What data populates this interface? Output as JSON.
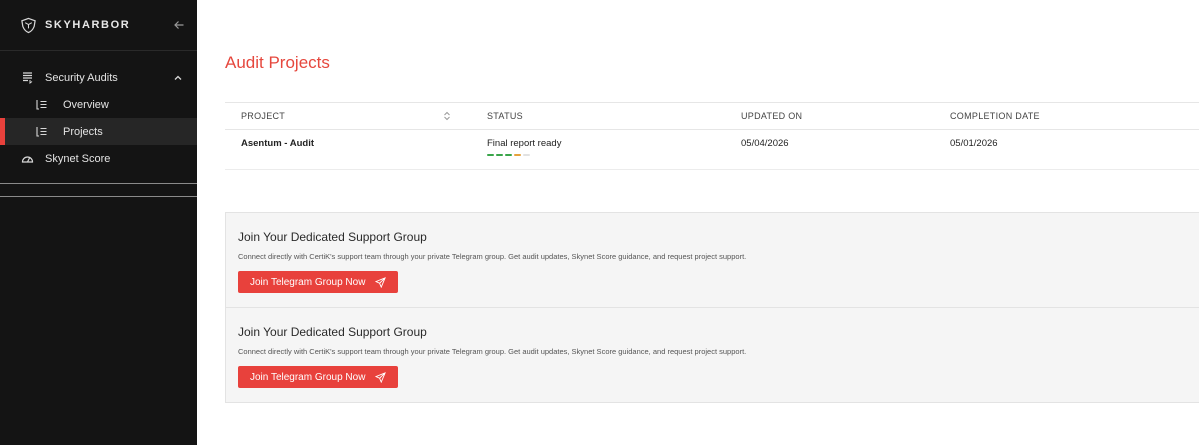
{
  "brand": {
    "name": "SKYHARBOR"
  },
  "sidebar": {
    "items": [
      {
        "label": "Security Audits",
        "icon": "document-list-icon",
        "expanded": true
      },
      {
        "label": "Overview",
        "icon": "list-icon"
      },
      {
        "label": "Projects",
        "icon": "list-icon",
        "active": true
      },
      {
        "label": "Skynet Score",
        "icon": "gauge-icon"
      }
    ]
  },
  "main": {
    "title": "Audit Projects",
    "table": {
      "headers": [
        "PROJECT",
        "STATUS",
        "UPDATED ON",
        "COMPLETION DATE"
      ],
      "rows": [
        {
          "project": "Asentum - Audit",
          "status": "Final report ready",
          "progress_colors": [
            "#3aa54a",
            "#3aa54a",
            "#3aa54a",
            "#e6a23c",
            "#e2e2e2"
          ],
          "updated_on": "05/04/2026",
          "completion_date": "05/01/2026"
        }
      ]
    },
    "support_cards": [
      {
        "title": "Join Your Dedicated Support Group",
        "description": "Connect directly with CertiK's support team through your private Telegram group. Get audit updates, Skynet Score guidance, and request project support.",
        "button_label": "Join Telegram Group Now"
      },
      {
        "title": "Join Your Dedicated Support Group",
        "description": "Connect directly with CertiK's support team through your private Telegram group. Get audit updates, Skynet Score guidance, and request project support.",
        "button_label": "Join Telegram Group Now"
      }
    ]
  },
  "colors": {
    "accent": "#e8413c",
    "sidebar_bg": "#141414",
    "progress_done": "#3aa54a",
    "progress_current": "#e6a23c"
  }
}
